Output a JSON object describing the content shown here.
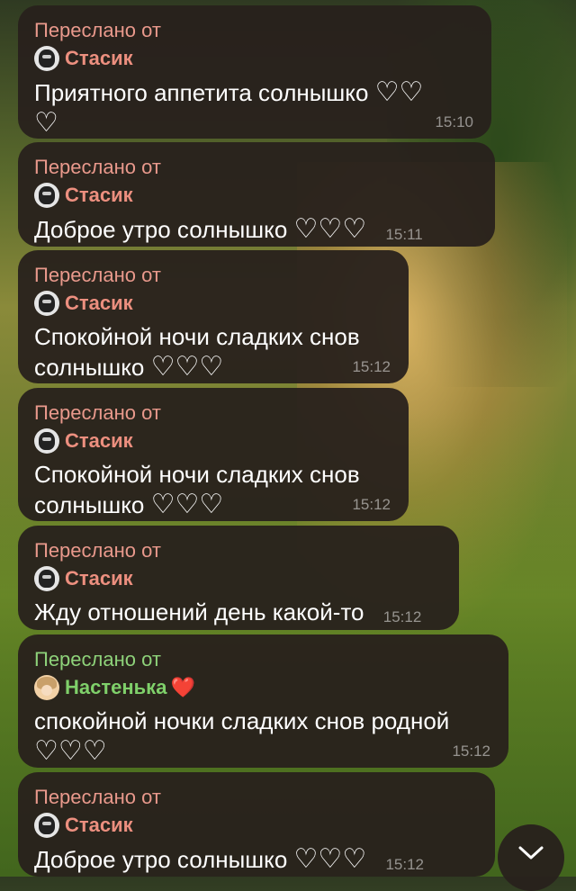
{
  "messages": [
    {
      "forward_label": "Переслано от",
      "sender": "Стасик",
      "text": "Приятного аппетита солнышко",
      "hearts": "♡♡",
      "hearts2": "♡",
      "time": "15:10"
    },
    {
      "forward_label": "Переслано от",
      "sender": "Стасик",
      "text": "Доброе утро солнышко",
      "hearts": "♡♡♡",
      "time": "15:11"
    },
    {
      "forward_label": "Переслано от",
      "sender": "Стасик",
      "text": "Спокойной ночи сладких снов",
      "text2": "солнышко",
      "hearts": "♡♡♡",
      "time": "15:12"
    },
    {
      "forward_label": "Переслано от",
      "sender": "Стасик",
      "text": "Спокойной ночи сладких снов",
      "text2": "солнышко",
      "hearts": "♡♡♡",
      "time": "15:12"
    },
    {
      "forward_label": "Переслано от",
      "sender": "Стасик",
      "text": "Жду отношений день какой-то",
      "time": "15:12"
    },
    {
      "forward_label": "Переслано от",
      "sender": "Настенька",
      "sender_emoji": "❤️",
      "text": "спокойной ночки сладких снов родной",
      "hearts": "♡♡♡",
      "time": "15:12"
    },
    {
      "forward_label": "Переслано от",
      "sender": "Стасик",
      "text": "Доброе утро солнышко",
      "hearts": "♡♡♡",
      "time": "15:12"
    }
  ],
  "scroll_button": {
    "icon": "chevron-down-icon"
  },
  "colors": {
    "bubble": "#28211c",
    "forward_pink": "#e9998c",
    "forward_green": "#8ed27a",
    "sender_pink": "#ec8f7f",
    "sender_green": "#7fd06a"
  }
}
